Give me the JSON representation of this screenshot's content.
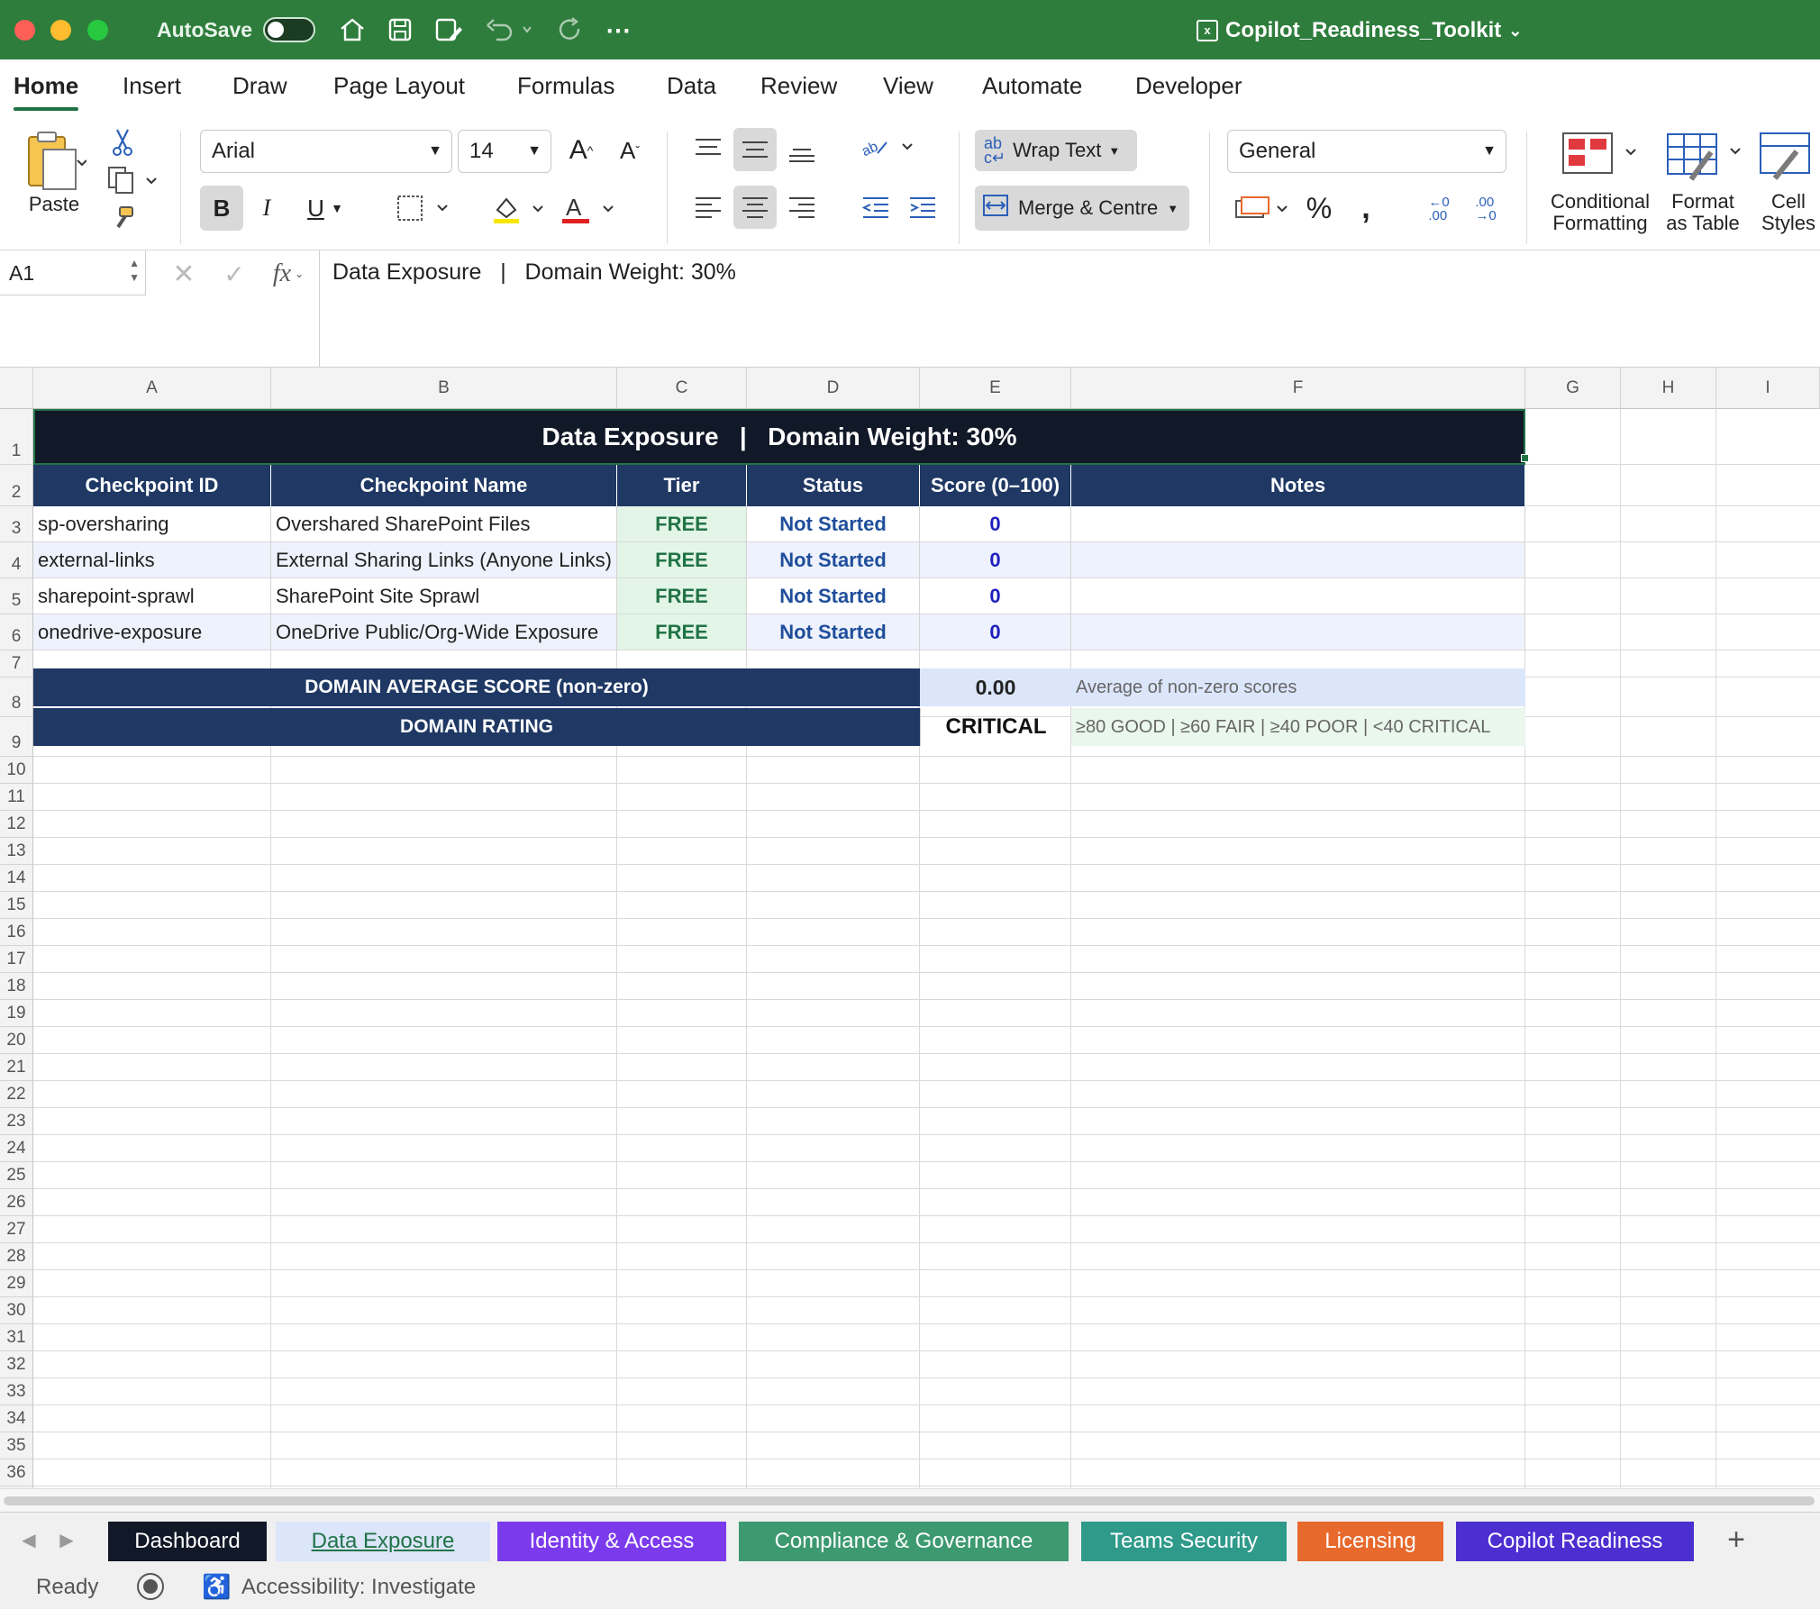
{
  "titlebar": {
    "autosave_label": "AutoSave",
    "doc_title": "Copilot_Readiness_Toolkit"
  },
  "menu_tabs": [
    "Home",
    "Insert",
    "Draw",
    "Page Layout",
    "Formulas",
    "Data",
    "Review",
    "View",
    "Automate",
    "Developer"
  ],
  "ribbon": {
    "paste_label": "Paste",
    "font_name": "Arial",
    "font_size": "14",
    "wrap_text_label": "Wrap Text",
    "merge_centre_label": "Merge & Centre",
    "number_format": "General",
    "cond_format_label_1": "Conditional",
    "cond_format_label_2": "Formatting",
    "format_table_label_1": "Format",
    "format_table_label_2": "as Table",
    "cell_styles_label_1": "Cell",
    "cell_styles_label_2": "Styles"
  },
  "formula_bar": {
    "name_box": "A1",
    "fx_label": "fx",
    "content": "Data Exposure   |   Domain Weight: 30%"
  },
  "columns": [
    "A",
    "B",
    "C",
    "D",
    "E",
    "F",
    "G",
    "H",
    "I"
  ],
  "sheet": {
    "title": "Data Exposure   |   Domain Weight: 30%",
    "headers": [
      "Checkpoint ID",
      "Checkpoint Name",
      "Tier",
      "Status",
      "Score (0–100)",
      "Notes"
    ],
    "rows": [
      {
        "id": "sp-oversharing",
        "name": "Overshared SharePoint Files",
        "tier": "FREE",
        "status": "Not Started",
        "score": "0",
        "notes": ""
      },
      {
        "id": "external-links",
        "name": "External Sharing Links (Anyone Links)",
        "tier": "FREE",
        "status": "Not Started",
        "score": "0",
        "notes": ""
      },
      {
        "id": "sharepoint-sprawl",
        "name": "SharePoint Site Sprawl",
        "tier": "FREE",
        "status": "Not Started",
        "score": "0",
        "notes": ""
      },
      {
        "id": "onedrive-exposure",
        "name": "OneDrive Public/Org-Wide Exposure",
        "tier": "FREE",
        "status": "Not Started",
        "score": "0",
        "notes": ""
      }
    ],
    "avg_label": "DOMAIN AVERAGE SCORE (non-zero)",
    "avg_value": "0.00",
    "avg_note": "Average of non-zero scores",
    "rating_label": "DOMAIN RATING",
    "rating_value": "CRITICAL",
    "rating_note": "≥80 GOOD | ≥60 FAIR | ≥40 POOR | <40 CRITICAL"
  },
  "sheet_tabs": [
    {
      "label": "Dashboard",
      "color": "#111827"
    },
    {
      "label": "Data Exposure",
      "color": "#dbe6fb"
    },
    {
      "label": "Identity & Access",
      "color": "#7c3aed"
    },
    {
      "label": "Compliance & Governance",
      "color": "#3d9970"
    },
    {
      "label": "Teams Security",
      "color": "#2f9a8a"
    },
    {
      "label": "Licensing",
      "color": "#e8692c"
    },
    {
      "label": "Copilot Readiness",
      "color": "#4c2fd1"
    }
  ],
  "statusbar": {
    "ready": "Ready",
    "accessibility": "Accessibility: Investigate"
  }
}
